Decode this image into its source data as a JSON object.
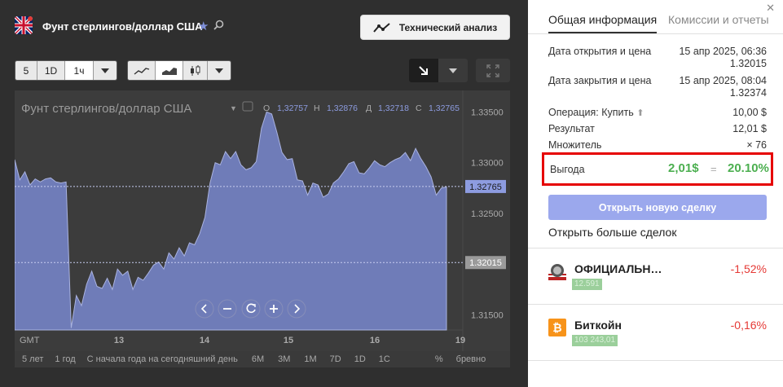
{
  "header": {
    "title": "Фунт стерлингов/доллар США",
    "ta_button": "Технический анализ"
  },
  "toolbar": {
    "periods": [
      "5",
      "1D",
      "1ч"
    ],
    "active_period": "1ч"
  },
  "chart": {
    "legend_title": "Фунт стерлингов/доллар США",
    "ohlc": {
      "o_label": "О",
      "o": "1,32757",
      "h_label": "Н",
      "h": "1,32876",
      "l_label": "Д",
      "l": "1,32718",
      "c_label": "С",
      "c": "1,32765"
    },
    "y_ticks": [
      "1.33500",
      "1.33000",
      "1.32500",
      "1.31500"
    ],
    "current_price_tag": "1.32765",
    "open_price_tag": "1.32015",
    "x_ticks": [
      "13",
      "14",
      "15",
      "16",
      "19"
    ],
    "gmt_label": "GMT",
    "timebar": [
      "5 лет",
      "1 год",
      "С начала года на сегодняшний день",
      "6M",
      "3M",
      "1M",
      "7D",
      "1D",
      "1C",
      "%",
      "бревно"
    ]
  },
  "chart_data": {
    "type": "area",
    "series": [
      {
        "values": [
          1.3303,
          1.3283,
          1.3291,
          1.3278,
          1.3284,
          1.3281,
          1.3284,
          1.3285,
          1.3281,
          1.328,
          1.3281,
          1.3137,
          1.3169,
          1.3159,
          1.318,
          1.3193,
          1.3178,
          1.3176,
          1.3186,
          1.3175,
          1.3195,
          1.3189,
          1.3193,
          1.3175,
          1.3187,
          1.3184,
          1.3191,
          1.3199,
          1.3202,
          1.3195,
          1.3211,
          1.3205,
          1.3216,
          1.3208,
          1.3221,
          1.3219,
          1.323,
          1.3246,
          1.328,
          1.33,
          1.3298,
          1.3311,
          1.3304,
          1.3311,
          1.3298,
          1.3293,
          1.3295,
          1.3301,
          1.3334,
          1.335,
          1.3348,
          1.333,
          1.331,
          1.3303,
          1.3304,
          1.3283,
          1.3282,
          1.3268,
          1.328,
          1.3278,
          1.3266,
          1.3269,
          1.328,
          1.3284,
          1.3291,
          1.3299,
          1.3301,
          1.329,
          1.3289,
          1.3295,
          1.3302,
          1.3298,
          1.3296,
          1.33,
          1.3303,
          1.3305,
          1.331,
          1.3302,
          1.3314,
          1.3304,
          1.3296,
          1.3286,
          1.3268,
          1.3275,
          1.3276
        ]
      }
    ],
    "ylim": [
      1.3135,
      1.336
    ],
    "x_ticks": [
      "13",
      "14",
      "15",
      "16",
      "19"
    ],
    "y_ticks": [
      1.335,
      1.33,
      1.325,
      1.315
    ],
    "reference_lines": [
      1.32765,
      1.32015
    ],
    "grid": false
  },
  "info": {
    "tab_general": "Общая информация",
    "tab_fees": "Комиссии и отчеты",
    "open_label": "Дата открытия и цена",
    "open_date": "15 апр 2025, 06:36",
    "open_price": "1.32015",
    "close_label": "Дата закрытия и цена",
    "close_date": "15 апр 2025, 08:04",
    "close_price": "1.32374",
    "operation_label": "Операция: Купить",
    "operation_value": "10,00 $",
    "result_label": "Результат",
    "result_value": "12,01 $",
    "multiplier_label": "Множитель",
    "multiplier_value": "× 76",
    "profit_label": "Выгода",
    "profit_value": "2,01$",
    "profit_eq": "=",
    "profit_pct": "20.10%",
    "open_new_button": "Открыть новую сделку",
    "more_deals": "Открыть больше сделок"
  },
  "assets": [
    {
      "name": "ОФИЦИАЛЬН…",
      "price": "12.591",
      "change": "-1,52%",
      "icon": "official-coin-icon"
    },
    {
      "name": "Биткойн",
      "price": "103 243,01",
      "change": "-0,16%",
      "icon": "bitcoin-icon"
    }
  ],
  "colors": {
    "area_fill": "#6f7cb8",
    "accent": "#7e8fd8",
    "profit": "#4caf50",
    "loss": "#e53935",
    "highlight_box": "#e60000"
  }
}
